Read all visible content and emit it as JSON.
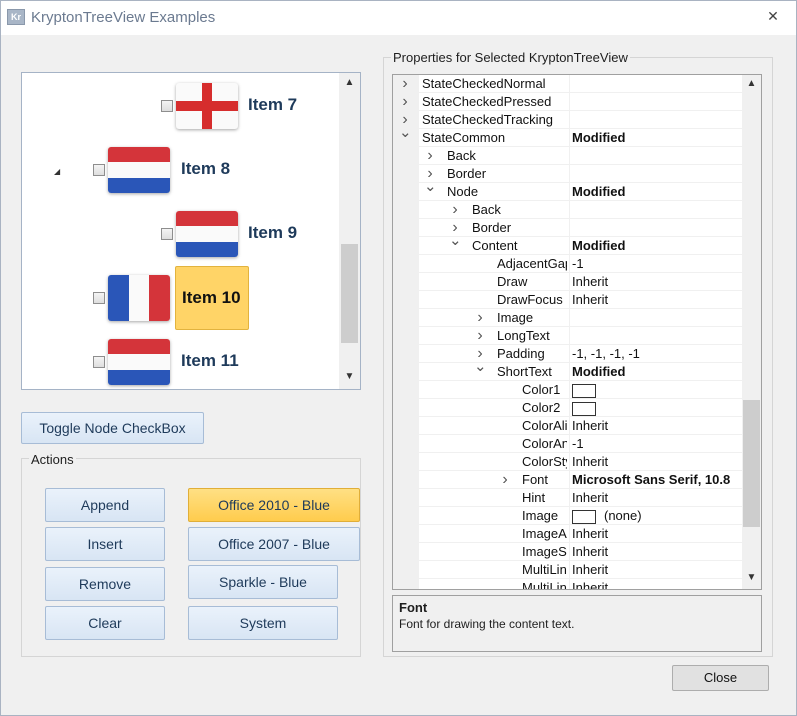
{
  "window": {
    "title": "KryptonTreeView Examples",
    "icon_text": "Kr"
  },
  "tree": {
    "items": [
      {
        "label": "Item 7",
        "flag": "england"
      },
      {
        "label": "Item 8",
        "flag": "netherlands"
      },
      {
        "label": "Item 9",
        "flag": "netherlands"
      },
      {
        "label": "Item 10",
        "flag": "france",
        "selected": true
      },
      {
        "label": "Item 11",
        "flag": "netherlands"
      }
    ]
  },
  "toggle_button": "Toggle Node CheckBox",
  "actions": {
    "label": "Actions",
    "buttons": [
      "Append",
      "Insert",
      "Remove",
      "Clear"
    ],
    "palettes": [
      "Office 2010 - Blue",
      "Office 2007 - Blue",
      "Sparkle - Blue",
      "System"
    ],
    "active_palette": "Office 2010 - Blue"
  },
  "properties": {
    "label": "Properties for Selected KryptonTreeView",
    "rows": [
      {
        "name": "StateCheckedNormal",
        "value": "",
        "level": 0,
        "exp": ">"
      },
      {
        "name": "StateCheckedPressed",
        "value": "",
        "level": 0,
        "exp": ">"
      },
      {
        "name": "StateCheckedTracking",
        "value": "",
        "level": 0,
        "exp": ">"
      },
      {
        "name": "StateCommon",
        "value": "Modified",
        "level": 0,
        "exp": "v",
        "bold": true
      },
      {
        "name": "Back",
        "value": "",
        "level": 1,
        "exp": ">"
      },
      {
        "name": "Border",
        "value": "",
        "level": 1,
        "exp": ">"
      },
      {
        "name": "Node",
        "value": "Modified",
        "level": 1,
        "exp": "v",
        "bold": true
      },
      {
        "name": "Back",
        "value": "",
        "level": 2,
        "exp": ">"
      },
      {
        "name": "Border",
        "value": "",
        "level": 2,
        "exp": ">"
      },
      {
        "name": "Content",
        "value": "Modified",
        "level": 2,
        "exp": "v",
        "bold": true
      },
      {
        "name": "AdjacentGap",
        "value": "-1",
        "level": 3,
        "exp": ""
      },
      {
        "name": "Draw",
        "value": "Inherit",
        "level": 3,
        "exp": ""
      },
      {
        "name": "DrawFocus",
        "value": "Inherit",
        "level": 3,
        "exp": ""
      },
      {
        "name": "Image",
        "value": "",
        "level": 3,
        "exp": ">"
      },
      {
        "name": "LongText",
        "value": "",
        "level": 3,
        "exp": ">"
      },
      {
        "name": "Padding",
        "value": "-1, -1, -1, -1",
        "level": 3,
        "exp": ">"
      },
      {
        "name": "ShortText",
        "value": "Modified",
        "level": 3,
        "exp": "v",
        "bold": true
      },
      {
        "name": "Color1",
        "value": "",
        "level": 4,
        "exp": "",
        "swatch": true
      },
      {
        "name": "Color2",
        "value": "",
        "level": 4,
        "exp": "",
        "swatch": true
      },
      {
        "name": "ColorAlign",
        "value": "Inherit",
        "level": 4,
        "exp": ""
      },
      {
        "name": "ColorAngle",
        "value": "-1",
        "level": 4,
        "exp": ""
      },
      {
        "name": "ColorStyle",
        "value": "Inherit",
        "level": 4,
        "exp": ""
      },
      {
        "name": "Font",
        "value": "Microsoft Sans Serif, 10.8",
        "level": 4,
        "exp": ">",
        "bold": true
      },
      {
        "name": "Hint",
        "value": "Inherit",
        "level": 4,
        "exp": ""
      },
      {
        "name": "Image",
        "value": "(none)",
        "level": 4,
        "exp": "",
        "swatch": true
      },
      {
        "name": "ImageAlign",
        "value": "Inherit",
        "level": 4,
        "exp": ""
      },
      {
        "name": "ImageStyle",
        "value": "Inherit",
        "level": 4,
        "exp": ""
      },
      {
        "name": "MultiLine",
        "value": "Inherit",
        "level": 4,
        "exp": ""
      },
      {
        "name": "MultiLineH",
        "value": "Inherit",
        "level": 4,
        "exp": ""
      }
    ],
    "description": {
      "title": "Font",
      "text": "Font for drawing the content text."
    }
  },
  "close_button": "Close",
  "colors": {
    "accent": "#ffd467",
    "button": "#d8e5f4",
    "tree_text": "#1e3a5a"
  }
}
